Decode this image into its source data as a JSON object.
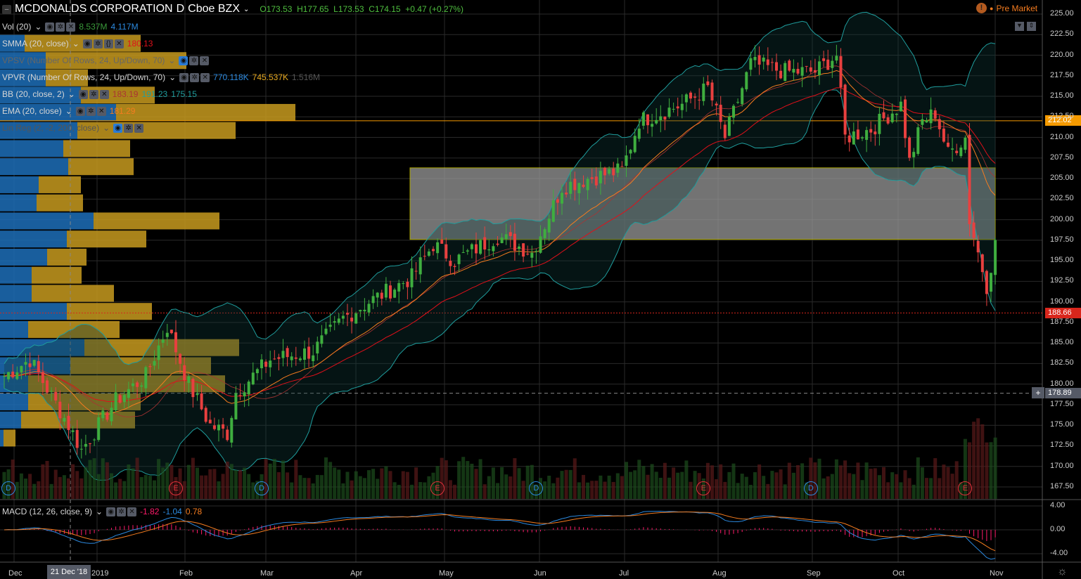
{
  "header": {
    "symbol": "MCDONALDS CORPORATION",
    "interval": "D",
    "exchange": "Cboe BZX",
    "open": "O173.53",
    "high": "H177.65",
    "low": "L173.53",
    "close": "C174.15",
    "change": "+0.47 (+0.27%)",
    "session": "Pre Market"
  },
  "indicators": {
    "vol": {
      "label": "Vol (20)",
      "v1": "8.537M",
      "v2": "4.117M"
    },
    "smma": {
      "label": "SMMA (20, close)",
      "v1": "180.13"
    },
    "vpsv": {
      "label": "VPSV (Number Of Rows, 24, Up/Down, 70)"
    },
    "vpvr": {
      "label": "VPVR (Number Of Rows, 24, Up/Down, 70)",
      "v1": "770.118K",
      "v2": "745.537K",
      "v3": "1.516M"
    },
    "bb": {
      "label": "BB (20, close, 2)",
      "v1": "183.19",
      "v2": "191.23",
      "v3": "175.15"
    },
    "ema": {
      "label": "EMA (20, close)",
      "v1": "181.29"
    },
    "linreg": {
      "label": "Lin Reg (2, -2, 200, close)"
    },
    "macd": {
      "label": "MACD (12, 26, close, 9)",
      "v1": "-1.82",
      "v2": "-1.04",
      "v3": "0.78"
    }
  },
  "price_tags": {
    "line": "212.02",
    "last": "188.66",
    "crosshair": "178.89"
  },
  "crosshair_date": "21 Dec '18",
  "colors": {
    "up": "#53b987",
    "down": "#eb4d5c",
    "upBody": "#3fae3f",
    "downBody": "#e8403f",
    "ema": "#f57c1f",
    "bb": "#1f9e9e",
    "smma": "#e0101a",
    "vpUp": "#1d6fb8",
    "vpDown": "#c79a1f"
  },
  "chart_data": {
    "type": "candlestick",
    "title": "MCDONALDS CORPORATION, D, Cboe BZX",
    "price_axis": {
      "range": [
        166,
        226
      ],
      "ticks": [
        "225.00",
        "222.50",
        "220.00",
        "217.50",
        "215.00",
        "212.50",
        "210.00",
        "207.50",
        "205.00",
        "202.50",
        "200.00",
        "197.50",
        "195.00",
        "192.50",
        "190.00",
        "187.50",
        "185.00",
        "182.50",
        "180.00",
        "177.50",
        "175.00",
        "172.50",
        "170.00",
        "167.50"
      ]
    },
    "macd_axis": {
      "range": [
        -5,
        5
      ],
      "ticks": [
        "4.00",
        "0.00",
        "-4.00"
      ]
    },
    "time_labels": [
      "Dec",
      "2019",
      "Feb",
      "Mar",
      "Apr",
      "May",
      "Jun",
      "Jul",
      "Aug",
      "Sep",
      "Oct",
      "Nov"
    ],
    "bars": 232,
    "close_keypoints": [
      [
        0,
        181
      ],
      [
        6,
        183
      ],
      [
        15,
        175
      ],
      [
        18,
        172
      ],
      [
        26,
        178
      ],
      [
        33,
        181
      ],
      [
        38,
        187
      ],
      [
        43,
        180
      ],
      [
        48,
        175
      ],
      [
        52,
        174
      ],
      [
        54,
        179
      ],
      [
        62,
        183
      ],
      [
        72,
        184
      ],
      [
        79,
        188
      ],
      [
        85,
        190
      ],
      [
        95,
        193
      ],
      [
        100,
        197
      ],
      [
        105,
        195
      ],
      [
        115,
        198
      ],
      [
        123,
        196
      ],
      [
        130,
        204
      ],
      [
        136,
        205
      ],
      [
        144,
        206
      ],
      [
        148,
        212
      ],
      [
        158,
        214
      ],
      [
        164,
        216
      ],
      [
        168,
        210
      ],
      [
        174,
        219
      ],
      [
        182,
        218
      ],
      [
        189,
        218
      ],
      [
        194,
        220
      ],
      [
        196,
        210
      ],
      [
        202,
        211
      ],
      [
        209,
        214
      ],
      [
        211,
        207
      ],
      [
        214,
        212
      ],
      [
        217,
        213
      ],
      [
        220,
        208
      ],
      [
        224,
        210
      ],
      [
        225,
        200
      ],
      [
        228,
        194
      ],
      [
        229,
        192
      ],
      [
        231,
        197
      ],
      [
        232,
        191
      ],
      [
        233,
        189
      ]
    ],
    "zone": {
      "low": 197.6,
      "high": 206.3
    },
    "hline": 212.02,
    "volume_profile": [
      {
        "price": 221.4,
        "up": 35,
        "down": 165
      },
      {
        "price": 219.3,
        "up": 65,
        "down": 200
      },
      {
        "price": 217.2,
        "up": 65,
        "down": 60
      },
      {
        "price": 215.1,
        "up": 115,
        "down": 105
      },
      {
        "price": 213.0,
        "up": 165,
        "down": 255
      },
      {
        "price": 210.8,
        "up": 110,
        "down": 225
      },
      {
        "price": 208.6,
        "up": 90,
        "down": 95
      },
      {
        "price": 206.4,
        "up": 97,
        "down": 93
      },
      {
        "price": 204.2,
        "up": 55,
        "down": 60
      },
      {
        "price": 202.0,
        "up": 52,
        "down": 66
      },
      {
        "price": 199.8,
        "up": 133,
        "down": 179
      },
      {
        "price": 197.6,
        "up": 95,
        "down": 113
      },
      {
        "price": 195.4,
        "up": 67,
        "down": 56
      },
      {
        "price": 193.2,
        "up": 45,
        "down": 71
      },
      {
        "price": 191.0,
        "up": 45,
        "down": 117
      },
      {
        "price": 188.8,
        "up": 95,
        "down": 121
      },
      {
        "price": 186.6,
        "up": 40,
        "down": 130
      },
      {
        "price": 184.4,
        "up": 120,
        "down": 220
      },
      {
        "price": 182.2,
        "up": 100,
        "down": 200
      },
      {
        "price": 180.0,
        "up": 40,
        "down": 280
      },
      {
        "price": 177.8,
        "up": 40,
        "down": 160
      },
      {
        "price": 175.6,
        "up": 30,
        "down": 162
      },
      {
        "price": 173.4,
        "up": 5,
        "down": 17
      }
    ],
    "events": [
      {
        "type": "D",
        "bar": 1
      },
      {
        "type": "E",
        "bar": 40
      },
      {
        "type": "D",
        "bar": 60
      },
      {
        "type": "E",
        "bar": 101
      },
      {
        "type": "D",
        "bar": 124
      },
      {
        "type": "E",
        "bar": 163
      },
      {
        "type": "D",
        "bar": 188
      },
      {
        "type": "E",
        "bar": 224
      }
    ]
  }
}
